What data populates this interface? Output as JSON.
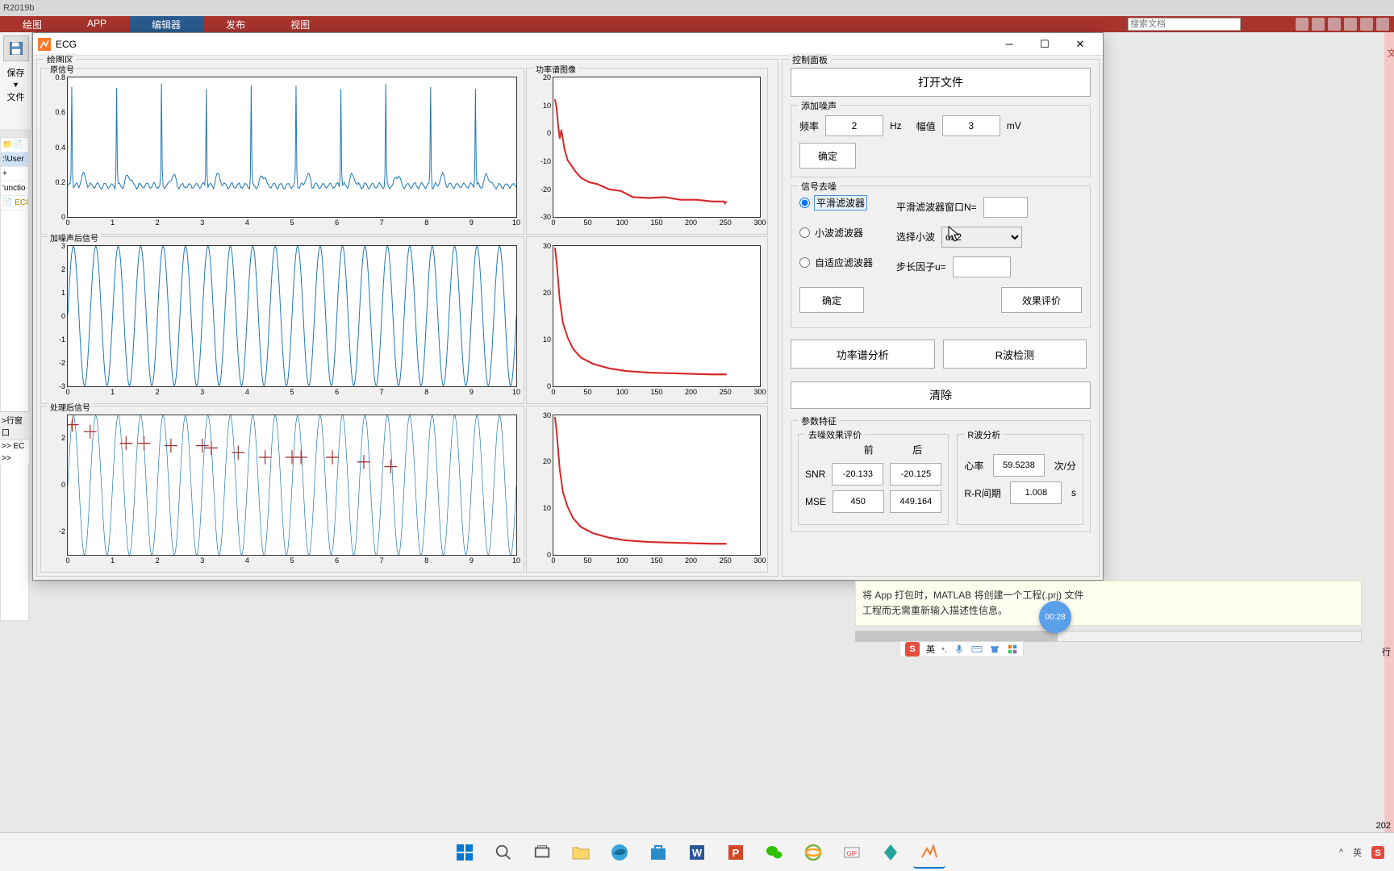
{
  "matlab": {
    "title": "R2019b",
    "ribbon_tabs": [
      "绘图",
      "APP",
      "编辑器",
      "发布",
      "视图"
    ],
    "active_tab": 2,
    "search_placeholder": "搜索文档",
    "leftbar": {
      "save_label": "保存",
      "file_label": "文件"
    },
    "filenav": [
      "📁📄",
      ":\\User",
      "+",
      "'unctio",
      "ECG"
    ],
    "cmd_hint": ">行窗口",
    "cmd_lines": [
      ">> EC",
      ">>"
    ]
  },
  "ecg": {
    "title": "ECG",
    "plot_region_title": "绘图区",
    "subplots": {
      "s1": "原信号",
      "s2": "功率谱图像",
      "s3": "加噪声后信号",
      "s5": "处理后信号"
    },
    "control_panel_title": "控制面板",
    "open_file": "打开文件",
    "noise_group": "添加噪声",
    "freq_label": "频率",
    "freq_val": "2",
    "freq_unit": "Hz",
    "amp_label": "幅值",
    "amp_val": "3",
    "amp_unit": "mV",
    "confirm": "确定",
    "denoise_group": "信号去噪",
    "filters": {
      "smooth": "平滑滤波器",
      "wavelet": "小波滤波器",
      "adaptive": "自适应滤波器"
    },
    "smooth_N": "平滑滤波器窗口N=",
    "smooth_N_val": "",
    "wavelet_label": "选择小波",
    "wavelet_val": "db2",
    "step_label": "步长因子u=",
    "step_val": "",
    "evaluate": "效果评价",
    "psd_analysis": "功率谱分析",
    "r_detect": "R波检测",
    "clear": "清除",
    "param_title": "参数特征",
    "eval_group": "去噪效果评价",
    "before": "前",
    "after": "后",
    "snr_label": "SNR",
    "snr_before": "-20.133",
    "snr_after": "-20.125",
    "mse_label": "MSE",
    "mse_before": "450",
    "mse_after": "449.164",
    "rwave_group": "R波分析",
    "hr_label": "心率",
    "hr_val": "59.5238",
    "hr_unit": "次/分",
    "rr_label": "R-R间期",
    "rr_val": "1.008",
    "rr_unit": "s"
  },
  "help_text": "将 App 打包时，MATLAB 将创建一个工程(.prj) 文件\n工程而无需重新输入描述性信息。",
  "badge_time": "00:28",
  "ime": {
    "s": "S",
    "lang": "英"
  },
  "tray": {
    "lang": "英",
    "up": "^"
  },
  "right_label": "文",
  "status_right": "202",
  "status_right2": "行",
  "chart_data": [
    {
      "id": "original_signal",
      "type": "line",
      "position": "row1-left",
      "title": "原信号",
      "xlim": [
        0,
        10
      ],
      "ylim": [
        0,
        0.8
      ],
      "xticks": [
        0,
        1,
        2,
        3,
        4,
        5,
        6,
        7,
        8,
        9,
        10
      ],
      "yticks": [
        0.2,
        0.4,
        0.6,
        0.8
      ],
      "note": "ECG waveform ~10 beats, baseline ~0.18, R-peaks ~0.75"
    },
    {
      "id": "psd_original",
      "type": "line",
      "position": "row1-right",
      "title": "功率谱图像",
      "xlim": [
        0,
        300
      ],
      "ylim": [
        -30,
        20
      ],
      "xticks": [
        0,
        50,
        100,
        150,
        200,
        250,
        300
      ],
      "yticks": [
        -30,
        -20,
        -10,
        0,
        10,
        20
      ],
      "note": "red curve decaying from ~12 at x=0 to ~-25 by x=100, flat ~-25 after"
    },
    {
      "id": "noisy_signal",
      "type": "line",
      "position": "row2-left",
      "title": "加噪声后信号",
      "xlim": [
        0,
        10
      ],
      "ylim": [
        -3,
        3
      ],
      "xticks": [
        0,
        1,
        2,
        3,
        4,
        5,
        6,
        7,
        8,
        9,
        10
      ],
      "yticks": [
        -3,
        -2,
        -1,
        0,
        1,
        2,
        3
      ],
      "note": "2Hz sine amplitude 3"
    },
    {
      "id": "psd_noisy",
      "type": "line",
      "position": "row2-right",
      "xlim": [
        0,
        300
      ],
      "ylim": [
        0,
        30
      ],
      "xticks": [
        0,
        50,
        100,
        150,
        200,
        250,
        300
      ],
      "yticks": [
        0,
        10,
        20,
        30
      ],
      "note": "red curve from 30 at x~2 decaying to ~3 by x=100"
    },
    {
      "id": "processed_signal",
      "type": "line",
      "position": "row3-left",
      "title": "处理后信号",
      "xlim": [
        0,
        10
      ],
      "ylim": [
        -3,
        3
      ],
      "xticks": [
        0,
        1,
        2,
        3,
        4,
        5,
        6,
        7,
        8,
        9,
        10
      ],
      "yticks": [
        -2,
        0,
        2
      ],
      "note": "sine + red cross markers",
      "r_marks_x": [
        0.1,
        0.5,
        1.3,
        1.7,
        2.3,
        3.0,
        3.2,
        3.8,
        4.4,
        5.0,
        5.2,
        5.9,
        6.6,
        7.2
      ],
      "r_marks_y": [
        2.6,
        2.3,
        1.8,
        1.8,
        1.7,
        1.7,
        1.6,
        1.4,
        1.2,
        1.2,
        1.2,
        1.2,
        1.0,
        0.8
      ]
    },
    {
      "id": "psd_processed",
      "type": "line",
      "position": "row3-right",
      "xlim": [
        0,
        300
      ],
      "ylim": [
        0,
        30
      ],
      "xticks": [
        0,
        50,
        100,
        150,
        200,
        250,
        300
      ],
      "yticks": [
        0,
        10,
        20,
        30
      ],
      "note": "same shape as psd_noisy"
    }
  ]
}
